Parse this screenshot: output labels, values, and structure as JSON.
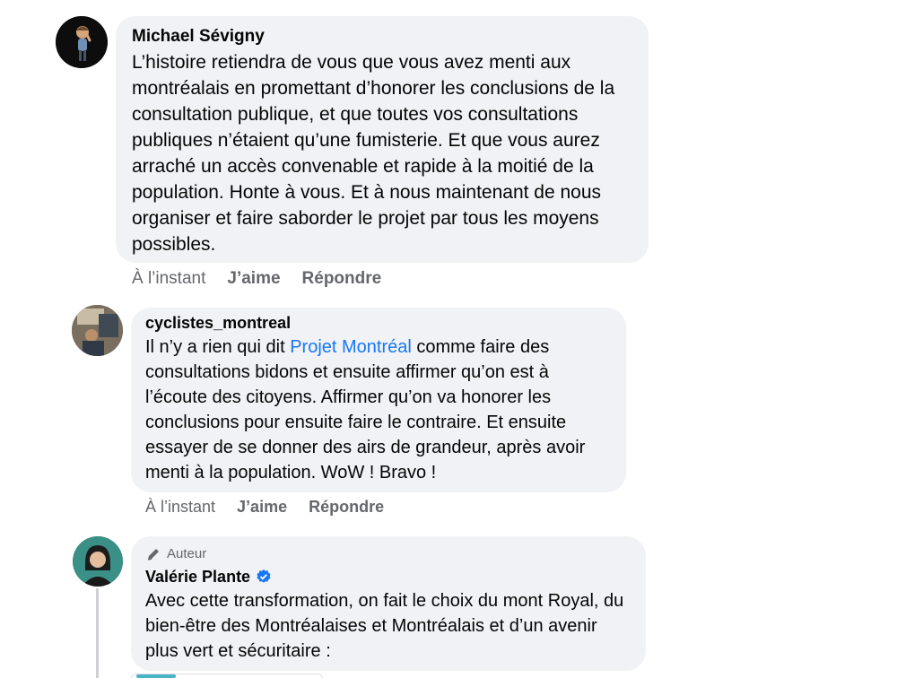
{
  "comments": [
    {
      "author": "Michael Sévigny",
      "text": "L’histoire retiendra de vous que vous avez menti aux montréalais en promettant d’honorer les conclusions de la consultation publique, et que toutes vos consultations publiques n’étaient qu’une fumisterie. Et que vous aurez arraché un accès convenable et rapide à la moitié de la population. Honte à vous. Et à nous maintenant de nous organiser et faire saborder le projet par tous les moyens possibles.",
      "time": "À l’instant",
      "like_label": "J’aime",
      "reply_label": "Répondre"
    },
    {
      "author": "cyclistes_montreal",
      "text_before": "Il n’y a rien qui dit ",
      "mention": "Projet Montréal",
      "text_after": " comme faire des consultations bidons et ensuite affirmer qu’on est à l’écoute des citoyens. Affirmer qu’on va honorer les conclusions pour ensuite faire le contraire. Et ensuite essayer de se donner des airs de grandeur, après avoir menti à la population. WoW ! Bravo !",
      "time": "À l’instant",
      "like_label": "J’aime",
      "reply_label": "Répondre"
    },
    {
      "badge": "Auteur",
      "author": "Valérie Plante",
      "verified": true,
      "text": "Avec cette transformation, on fait le choix du mont Royal, du bien-être des Montréalaises et Montréalais et d’un avenir plus vert et sécuritaire :"
    }
  ],
  "colors": {
    "bubble": "#f0f2f5",
    "mention": "#1877f2",
    "verified": "#1877f2",
    "meta": "#65676b"
  }
}
